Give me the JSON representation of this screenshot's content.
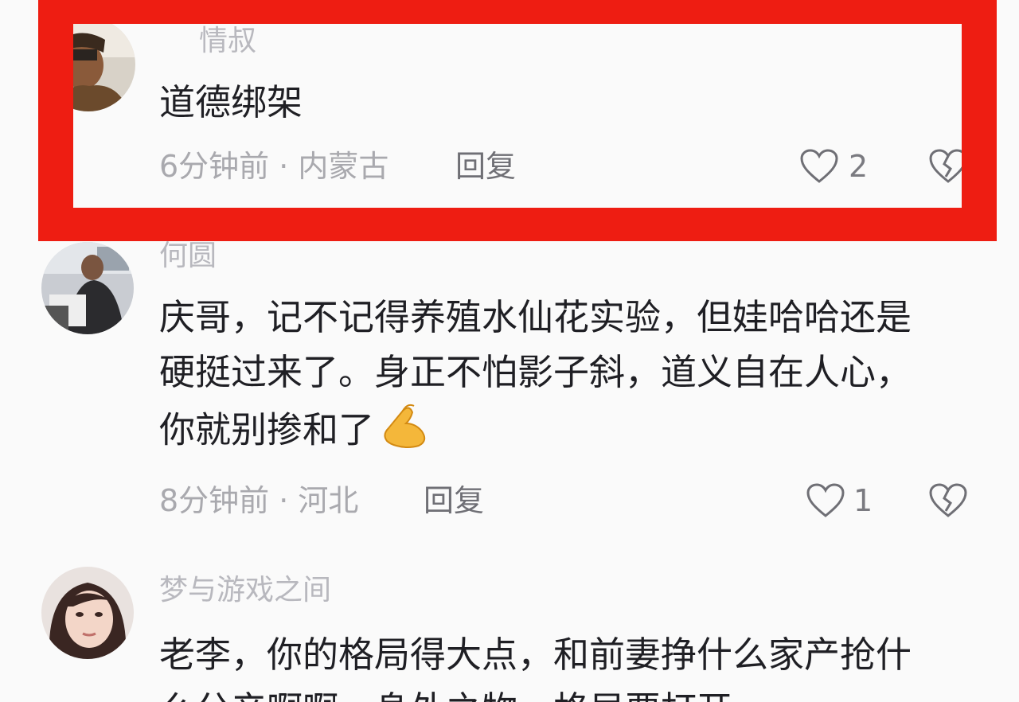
{
  "colors": {
    "highlight": "#ee1d12",
    "username": "#b8b8be",
    "body_text": "#1f1f24",
    "meta": "#a9a9ae",
    "background": "#fafafa"
  },
  "comments": [
    {
      "username": "情叔",
      "lines": [
        "道德绑架"
      ],
      "time_location": "6分钟前 · 内蒙古",
      "reply_label": "回复",
      "likes": "2",
      "highlighted": true
    },
    {
      "username": "何圆",
      "lines": [
        "庆哥，记不记得养殖水仙花实验，但娃哈哈还是",
        "硬挺过来了。身正不怕影子斜，道义自在人心，",
        "你就别掺和了"
      ],
      "emoji": "ok-hand-emoji",
      "time_location": "8分钟前 · 河北",
      "reply_label": "回复",
      "likes": "1",
      "highlighted": false
    },
    {
      "username": "梦与游戏之间",
      "lines": [
        "老李，你的格局得大点，和前妻挣什么家产抢什",
        "么分产啊啊，身外之物，格局要打开"
      ],
      "highlighted": false
    }
  ],
  "icons": {
    "like": "heart-outline-icon",
    "dislike": "broken-heart-icon"
  }
}
